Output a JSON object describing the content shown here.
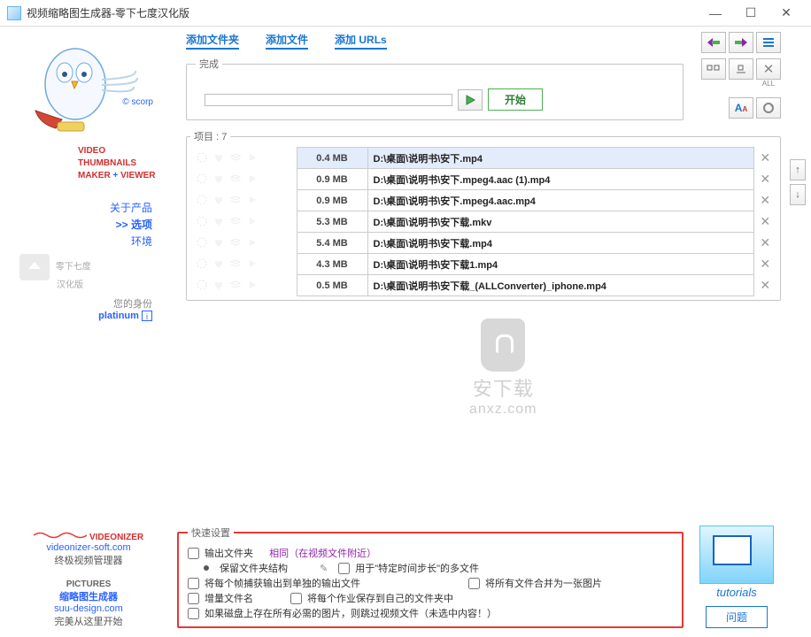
{
  "window": {
    "title": "视频缩略图生成器-零下七度汉化版"
  },
  "brand": {
    "l1": "VIDEO",
    "l2": "THUMBNAILS",
    "l3a": "MAKER",
    "l3plus": "+",
    "l3b": "VIEWER",
    "scorp": "© scorp"
  },
  "sidebar": {
    "about": "关于产品",
    "options": ">> 选项",
    "env": "环境",
    "cap1": "零下七度",
    "cap2": "汉化版",
    "identity_label": "您的身份",
    "identity_value": "platinum",
    "videonizer": "VIDEONIZER",
    "videonizer_url": "videonizer-soft.com",
    "videonizer_sub": "终极视频管理器",
    "pictures": "PICTURES",
    "pictures_sub": "缩略图生成器",
    "suu": "suu-design.com",
    "suu_sub": "完美从这里开始"
  },
  "toplinks": {
    "add_folder": "添加文件夹",
    "add_file": "添加文件",
    "add_urls": "添加 URLs"
  },
  "toolbar": {
    "all": "ALL"
  },
  "progress": {
    "legend": "完成",
    "start": "开始"
  },
  "items": {
    "legend_prefix": "项目 :",
    "count": "7",
    "rows": [
      {
        "size": "0.4 MB",
        "path": "D:\\桌面\\说明书\\安下.mp4",
        "selected": true
      },
      {
        "size": "0.9 MB",
        "path": "D:\\桌面\\说明书\\安下.mpeg4.aac (1).mp4",
        "selected": false
      },
      {
        "size": "0.9 MB",
        "path": "D:\\桌面\\说明书\\安下.mpeg4.aac.mp4",
        "selected": false
      },
      {
        "size": "5.3 MB",
        "path": "D:\\桌面\\说明书\\安下载.mkv",
        "selected": false
      },
      {
        "size": "5.4 MB",
        "path": "D:\\桌面\\说明书\\安下载.mp4",
        "selected": false
      },
      {
        "size": "4.3 MB",
        "path": "D:\\桌面\\说明书\\安下载1.mp4",
        "selected": false
      },
      {
        "size": "0.5 MB",
        "path": "D:\\桌面\\说明书\\安下载_(ALLConverter)_iphone.mp4",
        "selected": false
      }
    ]
  },
  "watermark": {
    "l1": "安下载",
    "l2": "anxz.com"
  },
  "qs": {
    "legend": "快速设置",
    "out_folder": "输出文件夹",
    "same_near": "相同（在视频文件附近）",
    "keep_struct": "保留文件夹结构",
    "time_step": "用于\"特定时间步长\"的多文件",
    "frame_to_file": "将每个帧捕获输出到单独的输出文件",
    "merge_one": "将所有文件合并为一张图片",
    "inc_name": "增量文件名",
    "save_own_dir": "将每个作业保存到自己的文件夹中",
    "skip_existing": "如果磁盘上存在所有必需的图片，则跳过视频文件（未选中内容！）"
  },
  "br": {
    "tutorials": "tutorials",
    "question": "问题"
  }
}
